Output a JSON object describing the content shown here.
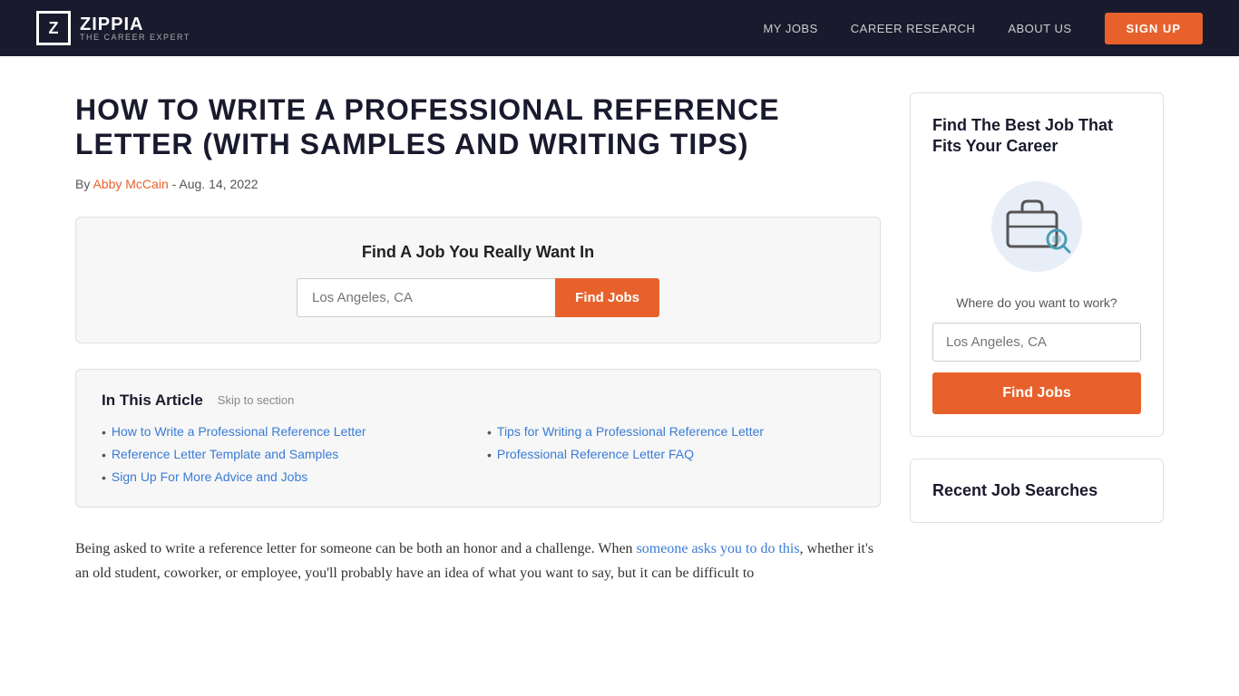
{
  "navbar": {
    "logo_letter": "Z",
    "logo_name": "ZIPPIA",
    "logo_tagline": "THE CAREER EXPERT",
    "links": [
      {
        "label": "MY JOBS",
        "href": "#"
      },
      {
        "label": "CAREER RESEARCH",
        "href": "#"
      },
      {
        "label": "ABOUT US",
        "href": "#"
      }
    ],
    "signup_label": "SIGN UP"
  },
  "article": {
    "title": "HOW TO WRITE A PROFESSIONAL REFERENCE LETTER (WITH SAMPLES AND WRITING TIPS)",
    "meta_prefix": "By",
    "author": "Abby McCain",
    "date": "- Aug. 14, 2022"
  },
  "job_search": {
    "title": "Find A Job You Really Want In",
    "placeholder": "Los Angeles, CA",
    "button_label": "Find Jobs"
  },
  "in_article": {
    "title": "In This Article",
    "skip_label": "Skip to section",
    "links": [
      {
        "text": "How to Write a Professional Reference Letter",
        "href": "#"
      },
      {
        "text": "Tips for Writing a Professional Reference Letter",
        "href": "#"
      },
      {
        "text": "Reference Letter Template and Samples",
        "href": "#"
      },
      {
        "text": "Professional Reference Letter FAQ",
        "href": "#"
      },
      {
        "text": "Sign Up For More Advice and Jobs",
        "href": "#"
      }
    ]
  },
  "body_text": {
    "paragraph1_start": "Being asked to write a reference letter for someone can be both an honor and a challenge. When ",
    "paragraph1_link": "someone asks you to do this",
    "paragraph1_end": ", whether it's an old student, coworker, or employee, you'll probably have an idea of what you want to say, but it can be difficult to"
  },
  "sidebar": {
    "card1": {
      "title": "Find The Best Job That Fits Your Career",
      "where_label": "Where do you want to work?",
      "placeholder": "Los Angeles, CA",
      "button_label": "Find Jobs"
    },
    "card2": {
      "title": "Recent Job Searches"
    }
  }
}
